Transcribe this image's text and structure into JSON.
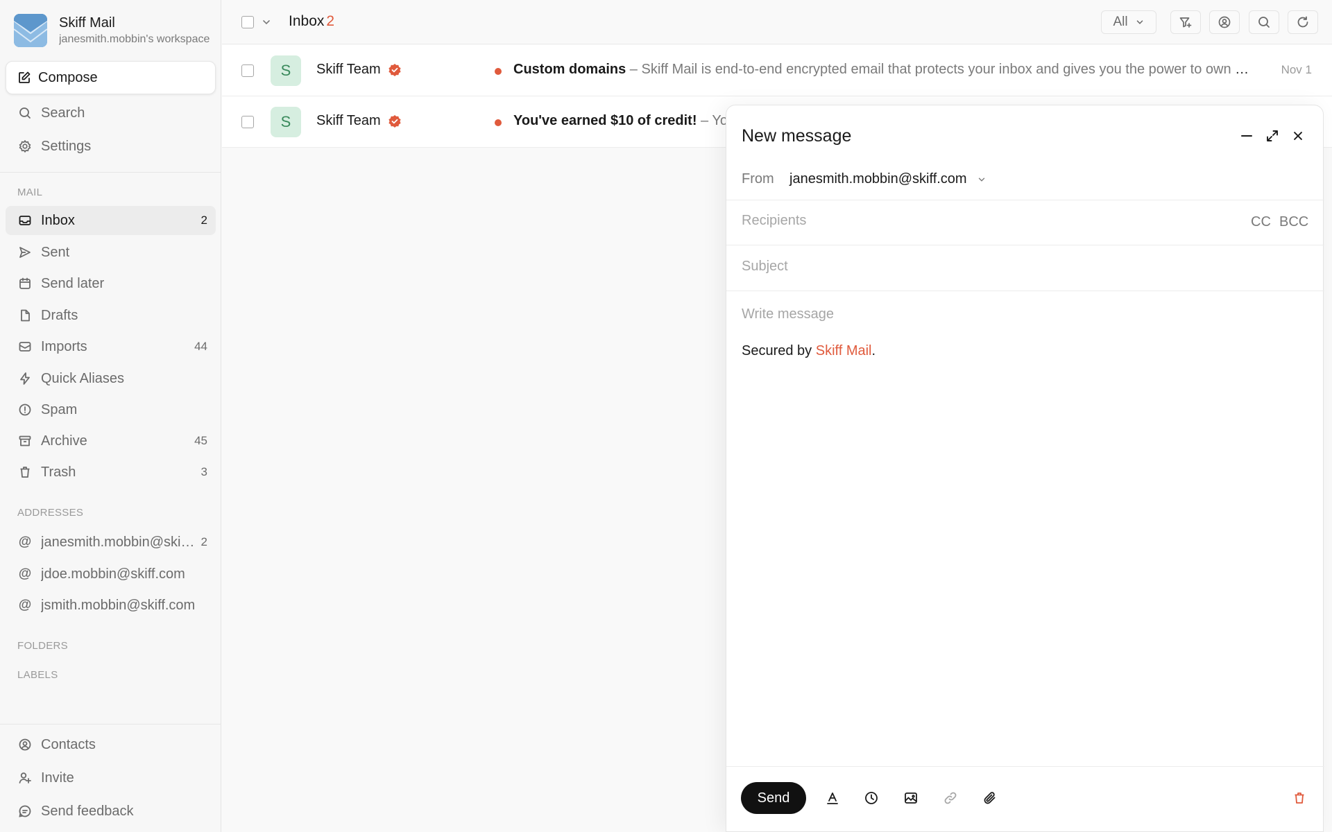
{
  "brand": {
    "name": "Skiff Mail",
    "subtitle": "janesmith.mobbin's workspace"
  },
  "sidebar": {
    "compose_label": "Compose",
    "top_items": [
      {
        "label": "Search",
        "icon": "search-icon"
      },
      {
        "label": "Settings",
        "icon": "gear-icon"
      }
    ],
    "mail_section": "MAIL",
    "mail_items": [
      {
        "label": "Inbox",
        "count": "2",
        "icon": "inbox-icon",
        "active": true
      },
      {
        "label": "Sent",
        "count": "",
        "icon": "send-icon"
      },
      {
        "label": "Send later",
        "count": "",
        "icon": "calendar-icon"
      },
      {
        "label": "Drafts",
        "count": "",
        "icon": "file-icon"
      },
      {
        "label": "Imports",
        "count": "44",
        "icon": "import-icon"
      },
      {
        "label": "Quick Aliases",
        "count": "",
        "icon": "bolt-icon"
      },
      {
        "label": "Spam",
        "count": "",
        "icon": "alert-icon"
      },
      {
        "label": "Archive",
        "count": "45",
        "icon": "archive-icon"
      },
      {
        "label": "Trash",
        "count": "3",
        "icon": "trash-icon"
      }
    ],
    "addresses_section": "ADDRESSES",
    "addresses": [
      {
        "label": "janesmith.mobbin@skiff.com",
        "count": "2"
      },
      {
        "label": "jdoe.mobbin@skiff.com",
        "count": ""
      },
      {
        "label": "jsmith.mobbin@skiff.com",
        "count": ""
      }
    ],
    "folders_section": "FOLDERS",
    "labels_section": "LABELS",
    "bottom_items": [
      {
        "label": "Contacts",
        "icon": "contacts-icon"
      },
      {
        "label": "Invite",
        "icon": "user-plus-icon"
      },
      {
        "label": "Send feedback",
        "icon": "feedback-icon"
      }
    ]
  },
  "toolbar": {
    "title": "Inbox",
    "count": "2",
    "filter_value": "All"
  },
  "mails": [
    {
      "sender": "Skiff Team",
      "avatar": "S",
      "subject": "Custom domains",
      "preview": " – Skiff Mail is end-to-end encrypted email that protects your inbox and gives you the power to own your data.",
      "date": "Nov 1"
    },
    {
      "sender": "Skiff Team",
      "avatar": "S",
      "subject": "You've earned $10 of credit!",
      "preview": " – Yo",
      "date": ""
    }
  ],
  "compose": {
    "title": "New message",
    "from_label": "From",
    "from_value": "janesmith.mobbin@skiff.com",
    "recipients_placeholder": "Recipients",
    "cc_label": "CC",
    "bcc_label": "BCC",
    "subject_placeholder": "Subject",
    "body_placeholder": "Write message",
    "signature_prefix": "Secured by ",
    "signature_link": "Skiff Mail",
    "signature_suffix": ".",
    "send_label": "Send"
  },
  "colors": {
    "accent": "#e05a3c",
    "send": "#111111",
    "avatar_bg": "#d6eee0"
  }
}
